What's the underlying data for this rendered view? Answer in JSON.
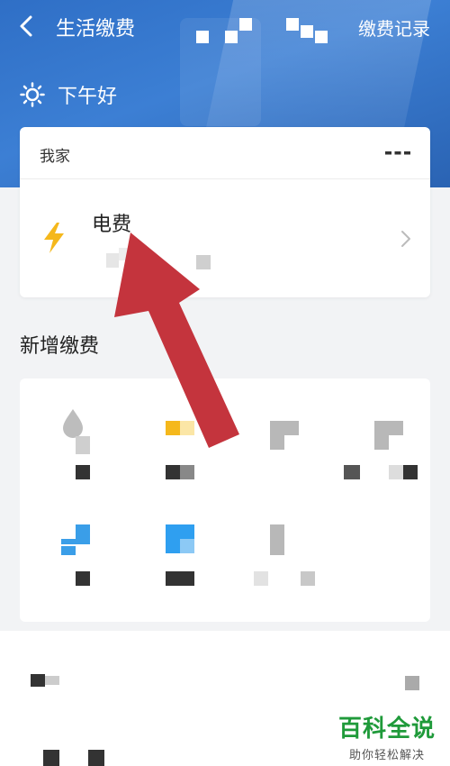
{
  "nav": {
    "title": "生活缴费",
    "records_label": "缴费记录"
  },
  "greeting": {
    "text": "下午好"
  },
  "home_card": {
    "label": "我家",
    "bill": {
      "name": "电费"
    }
  },
  "new_payment": {
    "title": "新增缴费"
  },
  "watermark": {
    "title": "百科全说",
    "subtitle": "助你轻松解决"
  },
  "colors": {
    "header_blue": "#3c7fd4",
    "bolt_yellow": "#f5b81c",
    "arrow_red": "#c0313a",
    "brand_green": "#1f9a3a"
  },
  "icons": [
    "back-icon",
    "sun-icon",
    "more-icon",
    "bolt-icon",
    "chevron-right-icon",
    "water-drop-icon"
  ]
}
